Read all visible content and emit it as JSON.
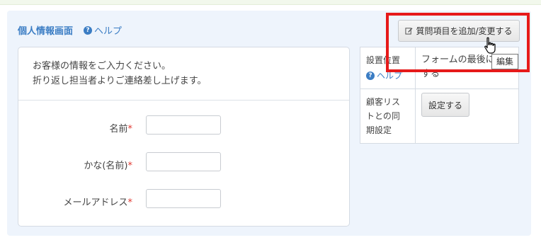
{
  "header": {
    "title": "個人情報画面",
    "help_label": "ヘルプ",
    "help_icon": "question-circle-icon"
  },
  "form": {
    "intro_line1": "お客様の情報をご入力ください。",
    "intro_line2": "折り返し担当者よりご連絡差し上げます。",
    "fields": [
      {
        "label": "名前",
        "required_mark": "*",
        "value": ""
      },
      {
        "label": "かな(名前)",
        "required_mark": "*",
        "value": ""
      },
      {
        "label": "メールアドレス",
        "required_mark": "*",
        "value": ""
      }
    ]
  },
  "toolbar": {
    "add_button_label": "質問項目を追加/変更する",
    "add_button_icon": "edit-icon",
    "tooltip": "編集"
  },
  "settings": {
    "placement_label": "設置位置",
    "placement_help": "ヘルプ",
    "placement_value_line1": "フォームの最後に",
    "placement_value_line2": "する",
    "sync_label_line1": "顧客リス",
    "sync_label_line2": "トとの同",
    "sync_label_line3": "期設定",
    "sync_button_label": "設定する"
  },
  "colors": {
    "accent": "#3b7dc4",
    "required": "#e0372f",
    "highlight": "#e61a1a",
    "panel_bg": "#eef4fc"
  }
}
